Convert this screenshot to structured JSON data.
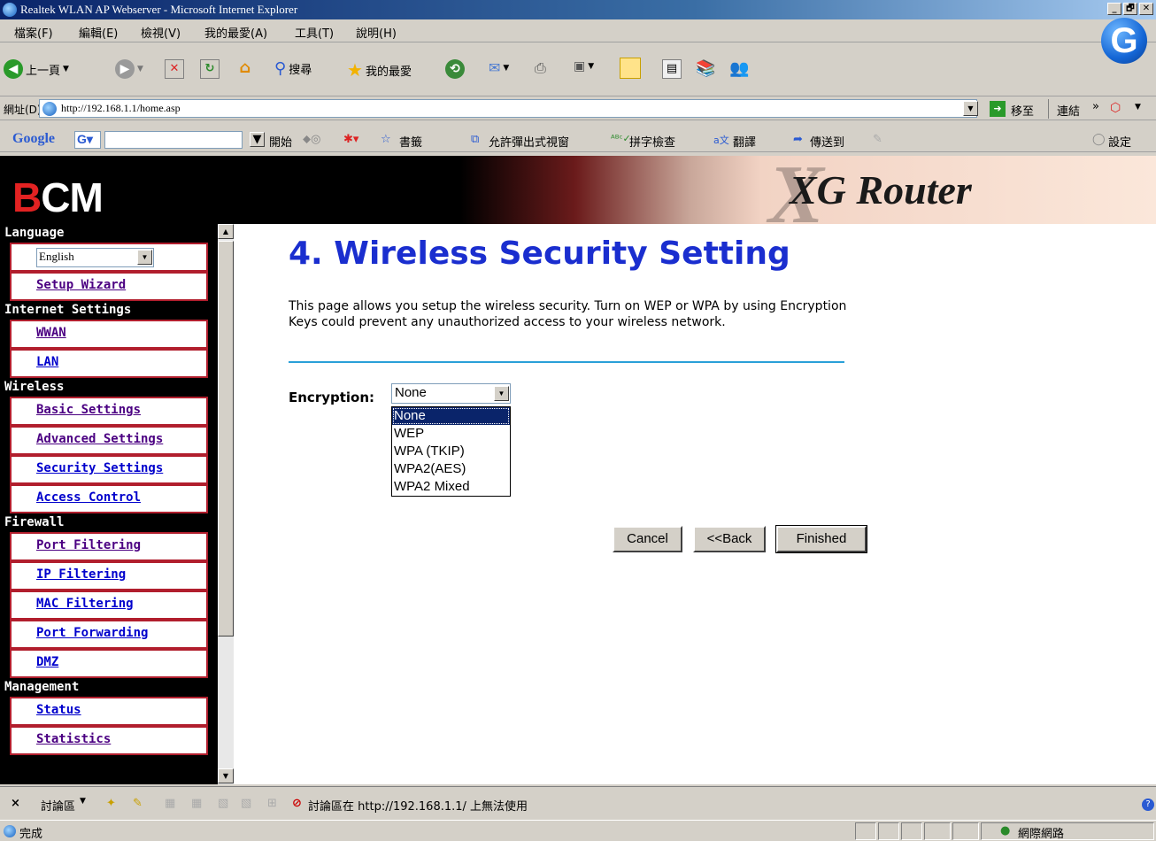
{
  "window": {
    "title": "Realtek WLAN AP Webserver - Microsoft Internet Explorer",
    "min": "_",
    "max": "🗗",
    "close": "✕"
  },
  "menu": [
    "檔案(F)",
    "編輯(E)",
    "檢視(V)",
    "我的最愛(A)",
    "工具(T)",
    "說明(H)"
  ],
  "toolbar": {
    "back": "上一頁",
    "search": "搜尋",
    "favorites": "我的最愛"
  },
  "address": {
    "label": "網址(D)",
    "url": "http://192.168.1.1/home.asp",
    "go": "移至",
    "links": "連結"
  },
  "google": {
    "logo": "Google",
    "start": "開始",
    "bookmarks": "書籤",
    "popups": "允許彈出式視窗",
    "spell": "拼字檢查",
    "translate": "翻譯",
    "sendto": "傳送到",
    "settings": "設定"
  },
  "banner": {
    "logo_b": "B",
    "logo_rest": "CM",
    "product": "XG Router"
  },
  "sidebar": {
    "language_header": "Language",
    "language_value": "English",
    "setup_wizard": "Setup Wizard",
    "internet_header": "Internet Settings",
    "wwan": "WWAN",
    "lan": "LAN",
    "wireless_header": "Wireless",
    "basic": "Basic Settings",
    "advanced": "Advanced Settings",
    "security": "Security Settings",
    "access": "Access Control",
    "firewall_header": "Firewall",
    "port_filtering": "Port Filtering",
    "ip_filtering": "IP Filtering",
    "mac_filtering": "MAC Filtering",
    "port_forwarding": "Port Forwarding",
    "dmz": "DMZ",
    "management_header": "Management",
    "status": "Status",
    "statistics": "Statistics"
  },
  "main": {
    "title": "4. Wireless Security Setting",
    "description": "This page allows you setup the wireless security. Turn on WEP or WPA by using Encryption Keys could prevent any unauthorized access to your wireless network.",
    "encryption_label": "Encryption:",
    "encryption_value": "None",
    "encryption_options": [
      "None",
      "WEP",
      "WPA (TKIP)",
      "WPA2(AES)",
      "WPA2 Mixed"
    ],
    "cancel": "Cancel",
    "back": "<<Back",
    "finished": "Finished"
  },
  "discuss": {
    "close": "×",
    "label": "討論區",
    "message": "討論區在 http://192.168.1.1/ 上無法使用"
  },
  "status": {
    "done": "完成",
    "zone": "網際網路"
  }
}
